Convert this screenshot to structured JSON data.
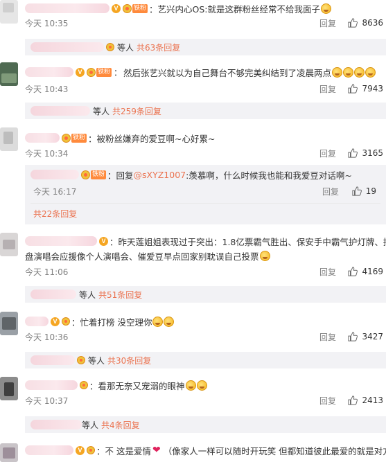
{
  "comments": [
    {
      "text": "：艺兴内心OS:就是这群粉丝经常不给我面子",
      "time": "今天 10:35",
      "reply_label": "回复",
      "likes": "8636",
      "sub": {
        "who": "等人",
        "count": "共63条回复"
      }
    },
    {
      "text": "然后张艺兴就以为自己舞台不够完美纠结到了凌晨两点",
      "time": "今天 10:43",
      "reply_label": "回复",
      "likes": "7943",
      "sub": {
        "who": "等人",
        "count": "共259条回复"
      }
    },
    {
      "text": "：被粉丝嫌弃的爱豆啊~心好累~",
      "time": "今天 10:34",
      "reply_label": "回复",
      "likes": "3165",
      "nested": {
        "prefix": "：回复",
        "mention": "@sXYZ1007",
        "text": ":羡慕啊，什么时候我也能和我爱豆对话啊~",
        "time": "今天 16:17",
        "reply_label": "回复",
        "likes": "19"
      },
      "more": "共22条回复"
    },
    {
      "text_line1": "：昨天莲姐姐表现过于突出：1.8亿票霸气胜出、保安手中霸气护灯牌、拼",
      "text_line2": "盘演唱会应援像个人演唱会、催爱豆早点回家别耽误自己投票",
      "time": "今天 11:06",
      "reply_label": "回复",
      "likes": "4169",
      "sub": {
        "who": "等人",
        "count": "共51条回复"
      }
    },
    {
      "text": "：忙着打榜 没空理你",
      "time": "今天 10:36",
      "reply_label": "回复",
      "likes": "3427",
      "sub": {
        "who": "等人",
        "count": "共30条回复"
      }
    },
    {
      "text": "：看那无奈又宠溺的眼神",
      "time": "今天 10:37",
      "reply_label": "回复",
      "likes": "2413",
      "sub": {
        "who": "等人",
        "count": "共4条回复"
      }
    },
    {
      "text_a": "：不 这是爱情",
      "text_b": "（像家人一样可以随时开玩笑 但都知道彼此最爱的就是对方"
    }
  ],
  "badges": {
    "fan_tag": "铁粉",
    "v_mark": "V"
  },
  "colors": {
    "accent": "#eb7350",
    "mention": "#eb7350",
    "meta_gray": "#808080",
    "sub_bg": "#f2f2f5"
  }
}
